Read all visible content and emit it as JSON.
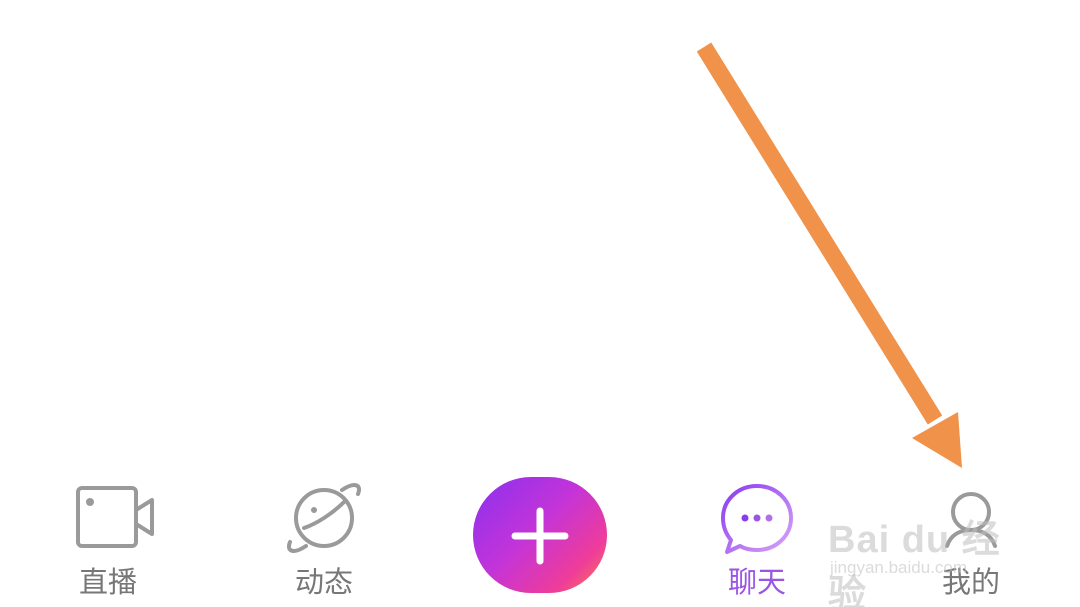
{
  "tabbar": {
    "items": [
      {
        "key": "live",
        "label": "直播",
        "icon": "video-camera-icon",
        "active": false
      },
      {
        "key": "feed",
        "label": "动态",
        "icon": "planet-icon",
        "active": false
      },
      {
        "key": "chat",
        "label": "聊天",
        "icon": "chat-bubble-icon",
        "active": true
      },
      {
        "key": "me",
        "label": "我的",
        "icon": "user-icon",
        "active": false
      }
    ],
    "center_button": {
      "icon": "plus-icon"
    }
  },
  "colors": {
    "inactive": "#777777",
    "active": "#9a55e6",
    "gradient_start": "#8a30f0",
    "gradient_end": "#ff7a4a",
    "arrow": "#f0924a"
  },
  "watermark": {
    "brand": "Bai du 经验",
    "url": "jingyan.baidu.com"
  }
}
